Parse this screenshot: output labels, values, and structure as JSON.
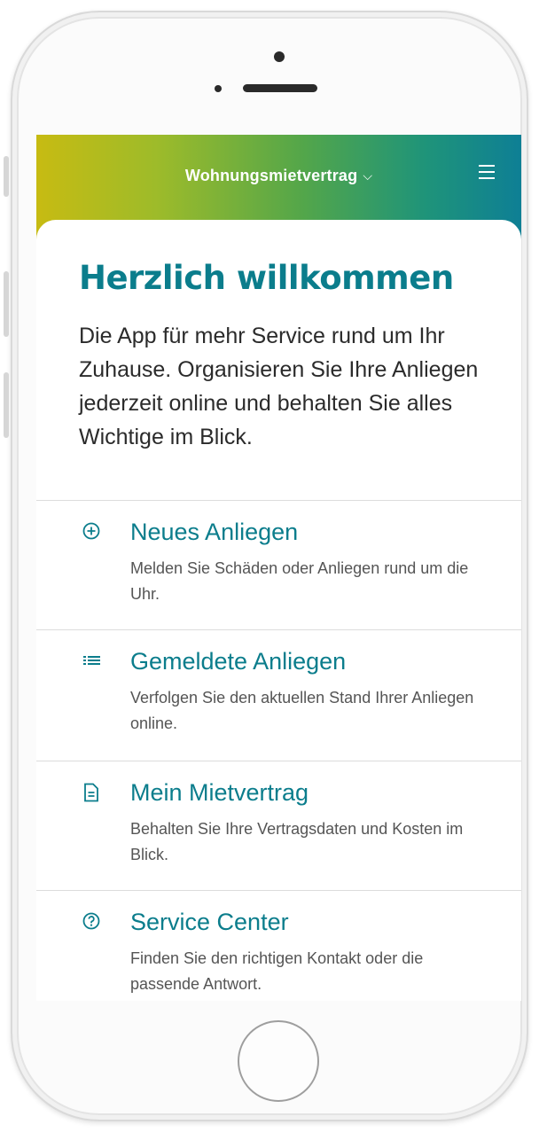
{
  "header": {
    "title": "Wohnungsmietvertrag",
    "chevron": "⌵",
    "menu_icon": "hamburger-menu-icon",
    "gradient": [
      "#c7bb12",
      "#53a64a",
      "#0e7f95"
    ]
  },
  "hero": {
    "title": "Herzlich willkommen",
    "text": "Die App für mehr Service rund um Ihr Zuhause. Organisieren Sie Ihre Anliegen jederzeit online und behalten Sie alles Wichtige im Blick."
  },
  "menu": {
    "items": [
      {
        "icon": "plus-circle-icon",
        "title": "Neues Anliegen",
        "desc": "Melden Sie Schäden oder Anliegen rund um die Uhr."
      },
      {
        "icon": "list-icon",
        "title": "Gemeldete Anliegen",
        "desc": "Verfolgen Sie den aktuellen Stand Ihrer Anliegen online."
      },
      {
        "icon": "document-icon",
        "title": "Mein Mietvertrag",
        "desc": "Behalten Sie Ihre Vertragsdaten und Kosten im Blick."
      },
      {
        "icon": "help-circle-icon",
        "title": "Service Center",
        "desc": "Finden Sie den richtigen Kontakt oder die passende Antwort."
      }
    ]
  },
  "colors": {
    "accent": "#0b7d8c",
    "text": "#2b2b2b",
    "muted": "#555555"
  }
}
